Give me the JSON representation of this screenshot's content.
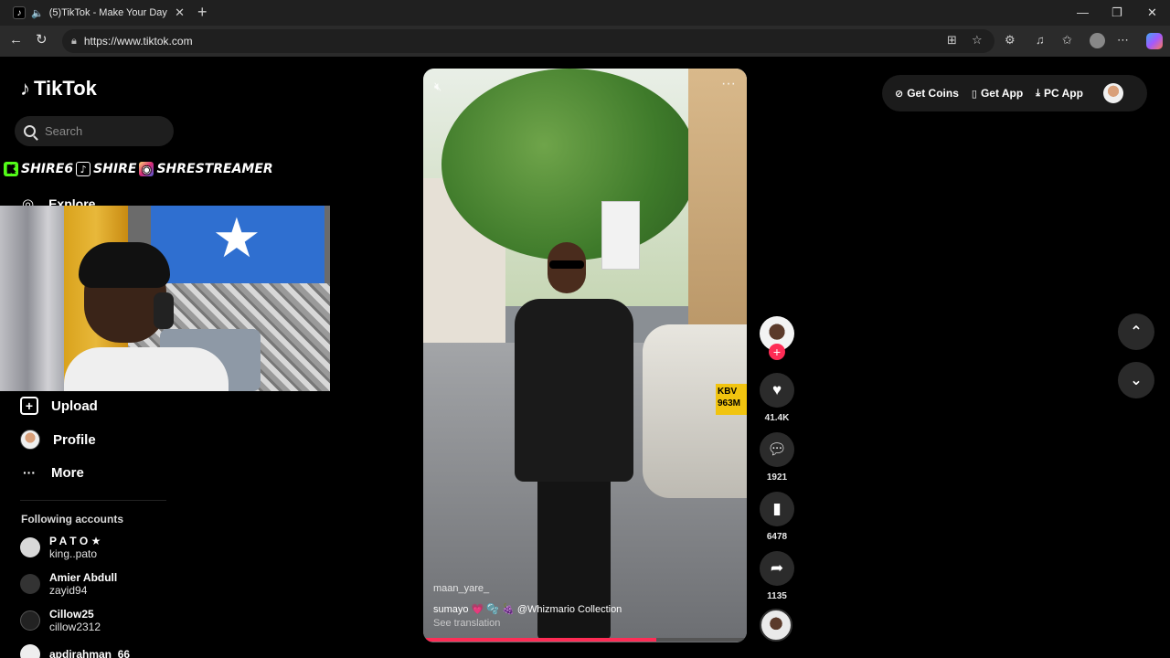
{
  "browser": {
    "tab_title": "(5)TikTok - Make Your Day",
    "tab_close": "✕",
    "new_tab": "+",
    "url": "https://www.tiktok.com",
    "window_controls": {
      "minimize": "—",
      "maximize": "❐",
      "close": "✕"
    }
  },
  "tiktok": {
    "logo_text": "TikTok",
    "search_placeholder": "Search",
    "overlay": {
      "kick_handle": "SHIRE6",
      "tiktok_handle": "SHIRE",
      "instagram_handle": "SHRESTREAMER"
    },
    "nav": {
      "explore": "Explore",
      "upload": "Upload",
      "profile": "Profile",
      "more": "More"
    },
    "following_heading": "Following accounts",
    "following_accounts": [
      {
        "name": "P A T O ★",
        "handle": "king..pato"
      },
      {
        "name": "Amier Abdull",
        "handle": "zayid94"
      },
      {
        "name": "Cillow25",
        "handle": "cillow2312"
      },
      {
        "name": "apdirahman_66",
        "handle": ""
      }
    ],
    "video": {
      "author": "maan_yare_",
      "caption": "sumayo 💗 🫧 🍇 @Whizmario Collection",
      "see_translation": "See translation",
      "plate": "KBV 963M",
      "progress": 0.72
    },
    "actions": {
      "likes": "41.4K",
      "comments": "1921",
      "saves": "6478",
      "shares": "1135"
    },
    "top_right": {
      "get_coins": "Get Coins",
      "get_app": "Get App",
      "pc_app": "PC App"
    },
    "colors": {
      "accent": "#fe2c55",
      "background": "#000000"
    }
  }
}
